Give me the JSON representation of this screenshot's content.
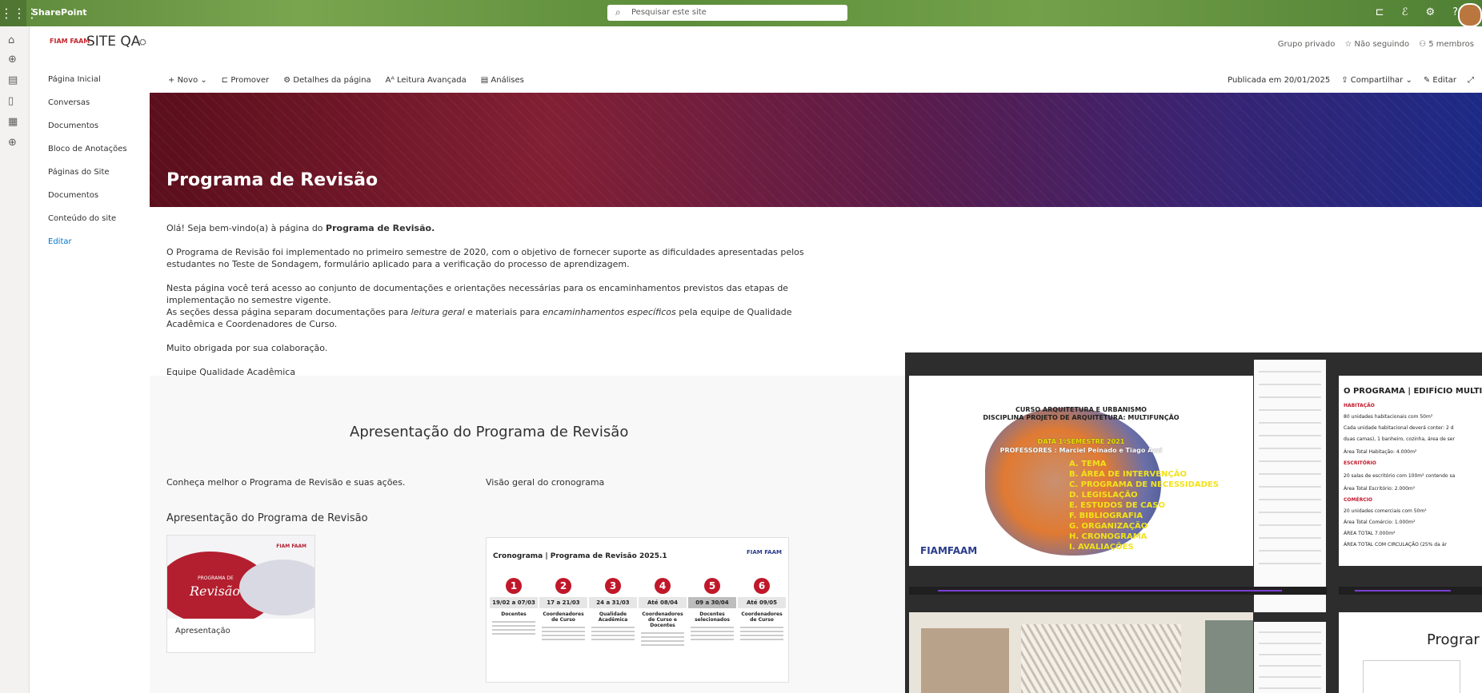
{
  "suite": {
    "brand": "SharePoint",
    "search_placeholder": "Pesquisar este site"
  },
  "site": {
    "logo_text": "FIAM FAAM",
    "title": "SITE QA",
    "lang_icon": "globe-lang-icon",
    "meta": {
      "privacy": "Grupo privado",
      "follow": "Não seguindo",
      "members": "5 membros"
    }
  },
  "leftnav": {
    "items": [
      {
        "label": "Página Inicial"
      },
      {
        "label": "Conversas"
      },
      {
        "label": "Documentos"
      },
      {
        "label": "Bloco de Anotações"
      },
      {
        "label": "Páginas do Site"
      },
      {
        "label": "Documentos"
      },
      {
        "label": "Conteúdo do site"
      },
      {
        "label": "Editar"
      }
    ]
  },
  "cmdbar": {
    "new": "Novo",
    "promote": "Promover",
    "details": "Detalhes da página",
    "reader": "Leitura Avançada",
    "analytics": "Análises",
    "published": "Publicada em 20/01/2025",
    "share": "Compartilhar",
    "edit": "Editar"
  },
  "hero": {
    "title": "Programa de Revisão"
  },
  "intro": {
    "p1_prefix": "Olá! Seja bem-vindo(a) à página do ",
    "p1_bold": "Programa de Revisão.",
    "p2": "O Programa de Revisão foi implementado no primeiro semestre de 2020, com o objetivo de fornecer suporte as dificuldades apresentadas pelos estudantes no Teste de Sondagem, formulário aplicado para a verificação do processo de aprendizagem.",
    "p3a": "Nesta página você terá acesso ao conjunto de documentações e orientações necessárias para os encaminhamentos previstos das etapas de implementação no semestre vigente.",
    "p3b_prefix": "As seções dessa página separam documentações para ",
    "p3b_it1": "leitura geral",
    "p3b_mid": " e materiais para ",
    "p3b_it2": "encaminhamentos específicos",
    "p3b_suffix": " pela equipe de Qualidade Acadêmica e Coordenadores de Curso.",
    "p4": "Muito obrigada por sua colaboração.",
    "p5": "Equipe Qualidade Acadêmica"
  },
  "section": {
    "title": "Apresentação do Programa de Revisão",
    "col1_label": "Conheça melhor o Programa de Revisão e suas ações.",
    "col2_label": "Visão geral do cronograma",
    "col1_heading": "Apresentação do Programa de Revisão",
    "card_thumb_small": "PROGRAMA DE",
    "card_thumb_big": "Revisão",
    "card_caption": "Apresentação"
  },
  "crono": {
    "title": "Cronograma | Programa de Revisão 2025.1",
    "logo": "FIAM FAAM",
    "steps": [
      {
        "n": "1",
        "date": "19/02 a 07/03",
        "role": "Docentes"
      },
      {
        "n": "2",
        "date": "17 a 21/03",
        "role": "Coordenadores de Curso"
      },
      {
        "n": "3",
        "date": "24 a 31/03",
        "role": "Qualidade Acadêmica"
      },
      {
        "n": "4",
        "date": "Até 08/04",
        "role": "Coordenadores de Curso e Docentes"
      },
      {
        "n": "5",
        "date": "09 a 30/04",
        "role": "Docentes selecionados"
      },
      {
        "n": "6",
        "date": "Até 09/05",
        "role": "Coordenadores de Curso"
      }
    ]
  },
  "overlay": {
    "slide1": {
      "l1": "CURSO ARQUITETURA E URBANISMO",
      "l2": "DISCIPLINA PROJETO DE ARQUITETURA: MULTIFUNÇÃO",
      "l3": "DATA 1ºSEMESTRE 2021",
      "l4": "PROFESSORES : Marciel Peinado e Tiago Azzi",
      "menu": [
        "A. TEMA",
        "B. ÁREA DE INTERVENÇÃO",
        "C. PROGRAMA DE NECESSIDADES",
        "D. LEGISLAÇÃO",
        "E. ESTUDOS DE CASO",
        "F. BIBLIOGRAFIA",
        "G. ORGANIZAÇÃO",
        "H. CRONOGRAMA",
        "I. AVALIAÇÕES"
      ],
      "brand": "FIAMFAAM"
    },
    "slide2": {
      "title": "O PROGRAMA | EDIFÍCIO MULTI",
      "rows": [
        {
          "t": "HABITAÇÃO",
          "red": true
        },
        {
          "t": "80 unidades habitacionais com 50m²",
          "red": false
        },
        {
          "t": "Cada unidade habitacional deverá conter: 2 d",
          "red": false
        },
        {
          "t": "duas camas), 1 banheiro, cozinha, área de ser",
          "red": false
        },
        {
          "t": "Área Total Habitação: 4.000m²",
          "red": false
        },
        {
          "t": "ESCRITÓRIO",
          "red": true
        },
        {
          "t": "20 salas de escritório com 100m² contendo sa",
          "red": false
        },
        {
          "t": "Área Total Escritório: 2.000m²",
          "red": false
        },
        {
          "t": "COMÉRCIO",
          "red": true
        },
        {
          "t": "20 unidades comerciais com 50m²",
          "red": false
        },
        {
          "t": "Área Total Comércio: 1.000m²",
          "red": false
        },
        {
          "t": "ÁREA TOTAL 7.000m²",
          "red": false
        },
        {
          "t": "ÁREA TOTAL COM CIRCULAÇÃO (25% da ár",
          "red": false
        }
      ]
    },
    "slide3": {
      "title": "Prograr"
    }
  }
}
